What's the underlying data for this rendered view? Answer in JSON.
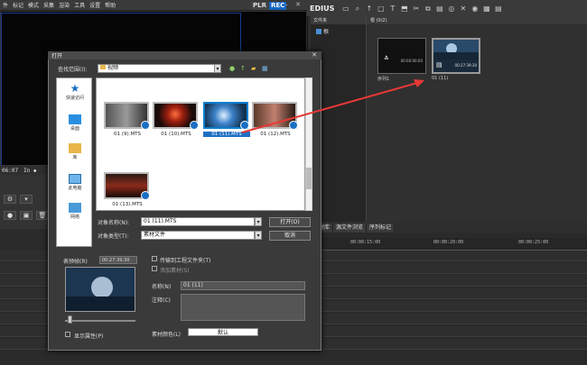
{
  "menubar": {
    "items": [
      "件",
      "标记",
      "模式",
      "采集",
      "渲染",
      "工具",
      "设置",
      "帮助"
    ],
    "plr": "PLR",
    "rec": "REC"
  },
  "main": {
    "timecode": "06:07",
    "timeline_marks": [
      "00:00:15:00",
      "00:00:20:00",
      "00:00:25:00"
    ]
  },
  "bin": {
    "brand": "EDIUS",
    "folder_header": "文件夹",
    "folder_item": "根",
    "clip_header": "根 (0/2)",
    "clips": [
      {
        "caption": "序列1",
        "tc": "00:00:00:00",
        "selected": false
      },
      {
        "caption": "01 (11)",
        "tc": "00:27:39:30",
        "selected": true
      }
    ],
    "tabs": [
      "素材库",
      "源文件浏览",
      "序列标记"
    ]
  },
  "dialog": {
    "title": "打开",
    "look_in_label": "查找范围(I):",
    "look_in_value": "视频",
    "places": [
      "快速访问",
      "桌面",
      "库",
      "此电脑",
      "网络"
    ],
    "files": [
      {
        "name": "01 (9).MTS",
        "selected": false
      },
      {
        "name": "01 (10).MTS",
        "selected": false
      },
      {
        "name": "01 (11).MTS",
        "selected": true
      },
      {
        "name": "01 (12).MTS",
        "selected": false
      },
      {
        "name": "01 (13).MTS",
        "selected": false
      }
    ],
    "file_name_label": "对象名称(N):",
    "file_name_value": "01 (11).MTS",
    "file_type_label": "对象类型(T):",
    "file_type_value": "素材文件",
    "open_button": "打开(O)",
    "cancel_button": "取消",
    "duration_label": "表预帧(R)",
    "duration_value": "00:27:39:30",
    "transfer_checkbox": "传输到工程文件夹(T)",
    "proxy_checkbox": "添加素材(S)",
    "name_label": "名称(N)",
    "name_value": "01 (11)",
    "comment_label": "注释(C)",
    "show_props_checkbox": "显示属性(P)",
    "color_label": "素材颜色(L)",
    "color_value": "默认"
  },
  "colors": {
    "accent": "#1e6fc4",
    "arrow": "#e53935",
    "rec": "#1565c0"
  }
}
